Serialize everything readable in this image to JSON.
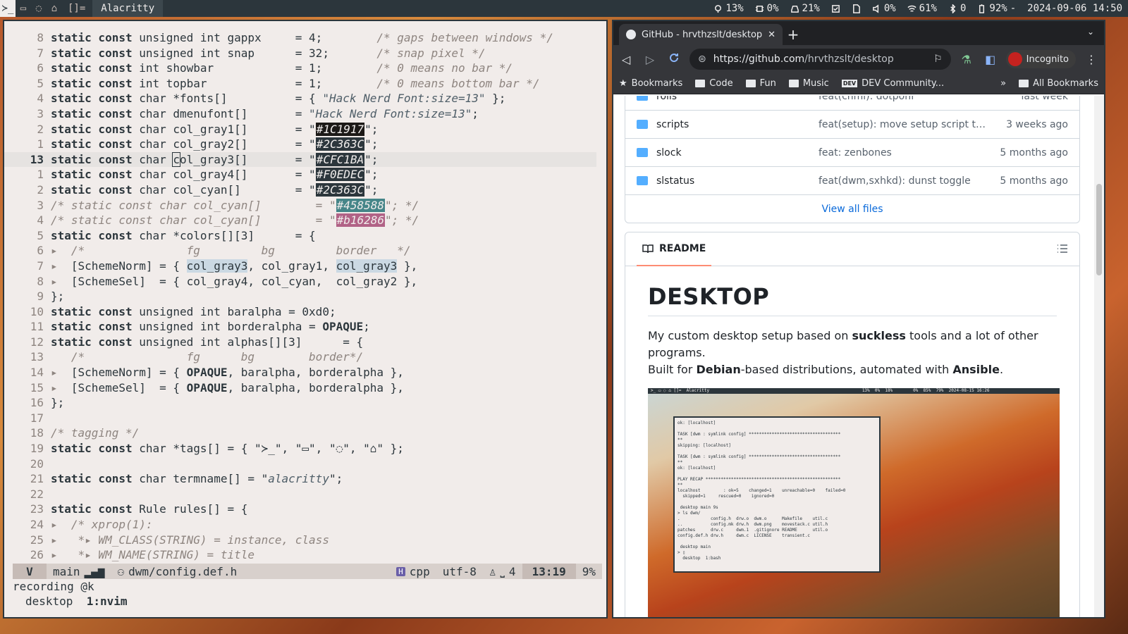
{
  "topbar": {
    "tags": [
      "≻_",
      "▭",
      "◌",
      "⌂"
    ],
    "layout": "[]=",
    "window_title": "Alacritty",
    "status": {
      "cpu": "13%",
      "temp": "0%",
      "disk": "21%",
      "volume": "0%",
      "wifi": "61%",
      "bluetooth": "0",
      "battery": "92%",
      "battery_state": "-",
      "datetime": "2024-09-06 14:50"
    }
  },
  "editor": {
    "lines": [
      {
        "n": "8",
        "html": "<span class='kw'>static const</span> unsigned int gappx     = 4;        <span class='cm'>/* gaps between windows */</span>"
      },
      {
        "n": "7",
        "html": "<span class='kw'>static const</span> unsigned int snap      = 32;       <span class='cm'>/* snap pixel */</span>"
      },
      {
        "n": "6",
        "html": "<span class='kw'>static const</span> int showbar            = 1;        <span class='cm'>/* 0 means no bar */</span>"
      },
      {
        "n": "5",
        "html": "<span class='kw'>static const</span> int topbar             = 1;        <span class='cm'>/* 0 means bottom bar */</span>"
      },
      {
        "n": "4",
        "html": "<span class='kw'>static const</span> char *fonts[]          = { <span class='st1'>\"Hack Nerd Font:size=13\"</span> };"
      },
      {
        "n": "3",
        "html": "<span class='kw'>static const</span> char dmenufont[]       = <span class='st1'>\"Hack Nerd Font:size=13\"</span>;"
      },
      {
        "n": "2",
        "html": "<span class='kw'>static const</span> char col_gray1[]       = \"<span class='sw' style='background:#1C1917'>#1C1917</span>\";"
      },
      {
        "n": "1",
        "html": "<span class='kw'>static const</span> char col_gray2[]       = \"<span class='sw' style='background:#2C363C'>#2C363C</span>\";"
      },
      {
        "n": "13",
        "cur": true,
        "html": "<span class='kw'>static const</span> char <span class='cursor'>c</span>ol_gray3[]       = \"<span class='sw' style='background:#2C363C'>#CFC1BA</span>\";"
      },
      {
        "n": "1",
        "html": "<span class='kw'>static const</span> char col_gray4[]       = \"<span class='sw' style='background:#2C363C'>#F0EDEC</span>\";"
      },
      {
        "n": "2",
        "html": "<span class='kw'>static const</span> char col_cyan[]        = \"<span class='sw' style='background:#2C363C'>#2C363C</span>\";"
      },
      {
        "n": "3",
        "html": "<span class='cm'>/* static const char col_cyan[]        = \"</span><span class='sw' style='background:#458588'>#458588</span><span class='cm'>\"; */</span>"
      },
      {
        "n": "4",
        "html": "<span class='cm'>/* static const char col_cyan[]        = \"</span><span class='sw' style='background:#b16286'>#b16286</span><span class='cm'>\"; */</span>"
      },
      {
        "n": "5",
        "html": "<span class='kw'>static const</span> char *colors[][3]      = {"
      },
      {
        "n": "6",
        "html": "<span class='cm'>▸  /*               fg         bg         border   */</span>"
      },
      {
        "n": "7",
        "html": "<span class='cm'>▸</span>  [SchemeNorm] = { <span class='hl'>col_gray3</span>, col_gray1, <span class='hl'>col_gray3</span> },"
      },
      {
        "n": "8",
        "html": "<span class='cm'>▸</span>  [SchemeSel]  = { col_gray4, col_cyan,  col_gray2 },"
      },
      {
        "n": "9",
        "html": "};"
      },
      {
        "n": "10",
        "html": "<span class='kw'>static const</span> unsigned int baralpha = 0xd0;"
      },
      {
        "n": "11",
        "html": "<span class='kw'>static const</span> unsigned int borderalpha = <span class='kw'>OPAQUE</span>;"
      },
      {
        "n": "12",
        "html": "<span class='kw'>static const</span> unsigned int alphas[][3]      = {"
      },
      {
        "n": "13",
        "html": "<span class='cm'>   /*               fg      bg        border*/</span>"
      },
      {
        "n": "14",
        "html": "<span class='cm'>▸</span>  [SchemeNorm] = { <span class='kw'>OPAQUE</span>, baralpha, borderalpha },"
      },
      {
        "n": "15",
        "html": "<span class='cm'>▸</span>  [SchemeSel]  = { <span class='kw'>OPAQUE</span>, baralpha, borderalpha },"
      },
      {
        "n": "16",
        "html": "};"
      },
      {
        "n": "17",
        "html": ""
      },
      {
        "n": "18",
        "html": "<span class='cm'>/* tagging */</span>"
      },
      {
        "n": "19",
        "html": "<span class='kw'>static const</span> char *tags[] = { \"≻_\", \"▭\", \"◌\", \"⌂\" };"
      },
      {
        "n": "20",
        "html": ""
      },
      {
        "n": "21",
        "html": "<span class='kw'>static const</span> char termname[] = \"<span class='st1'>alacritty</span>\";"
      },
      {
        "n": "22",
        "html": ""
      },
      {
        "n": "23",
        "html": "<span class='kw'>static const</span> Rule rules[] = {"
      },
      {
        "n": "24",
        "html": "<span class='cm'>▸  /* xprop(1):</span>"
      },
      {
        "n": "25",
        "html": "<span class='cm'>▸   *▸ WM_CLASS(STRING) = instance, class</span>"
      },
      {
        "n": "26",
        "html": "<span class='cm'>▸   *▸ WM_NAME(STRING) = title</span>"
      }
    ],
    "statusline": {
      "mode": "V",
      "branch": "main",
      "file": "dwm/config.def.h",
      "filetype": "cpp",
      "encoding": "utf-8",
      "indent": "4",
      "position": "13:19",
      "percent": "9%"
    },
    "cmdline": "recording @k",
    "tmux_session": "desktop",
    "tmux_window": "1:nvim"
  },
  "browser": {
    "tab_title": "GitHub - hrvthzslt/desktop:",
    "url_host": "https://github.com",
    "url_path": "/hrvthzslt/desktop",
    "incognito_label": "Incognito",
    "bookmarks": [
      {
        "label": "Bookmarks",
        "icon": "star"
      },
      {
        "label": "Code",
        "icon": "folder"
      },
      {
        "label": "Fun",
        "icon": "folder"
      },
      {
        "label": "Music",
        "icon": "folder"
      },
      {
        "label": "DEV Community...",
        "icon": "dev"
      }
    ],
    "all_bookmarks": "All Bookmarks",
    "overflow": "»",
    "partial_row": {
      "name": "rolls",
      "msg": "feat(chmi): dotponf",
      "age": "last week"
    },
    "files": [
      {
        "name": "scripts",
        "msg": "feat(setup): move setup script to m...",
        "age": "3 weeks ago"
      },
      {
        "name": "slock",
        "msg": "feat: zenbones",
        "age": "5 months ago"
      },
      {
        "name": "slstatus",
        "msg": "feat(dwm,sxhkd): dunst toggle",
        "age": "5 months ago"
      }
    ],
    "view_all": "View all files",
    "readme_tab": "README",
    "readme_title": "DESKTOP",
    "readme_p1_a": "My custom desktop setup based on ",
    "readme_p1_b": "suckless",
    "readme_p1_c": " tools and a lot of other programs.",
    "readme_p2_a": "Built for ",
    "readme_p2_b": "Debian",
    "readme_p2_c": "-based distributions, automated with ",
    "readme_p2_d": "Ansible",
    "readme_p2_e": ".",
    "screenshot_bar": "≻_ ▭ ◌ ⌂ []=  Alacritty                                                            13%  0%  18%        0%  85%  79%  2024-08-15 16:26",
    "screenshot_term": "ok: [localhost]\n\nTASK [dwm : symlink config] ************************************\n**\nskipping: [localhost]\n\nTASK [dwm : symlink config] ************************************\n**\nok: [localhost]\n\nPLAY RECAP *****************************************************\n**\nlocalhost         : ok=5    changed=1    unreachable=0    failed=0\n  skipped=1     rescued=0    ignored=0\n\n desktop main 9s\n> ls dwm/\n.            config.h  drw.o  dwm.o      Makefile    util.c\n..           config.mk drw.h  dwm.png    movestack.c util.h\npatches      drw.c     dwm.1  .gitignore README      util.o\nconfig.def.h drw.h     dwm.c  LICENSE    transient.c\n\n desktop main\n> ▯\n  desktop  1:bash"
  }
}
